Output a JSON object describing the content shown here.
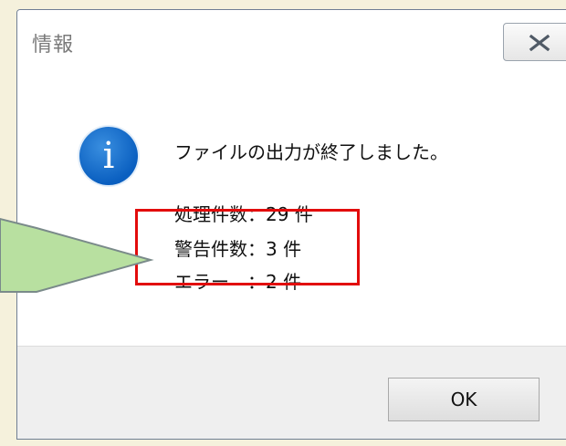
{
  "dialog": {
    "title": "情報",
    "message": "ファイルの出力が終了しました。",
    "lines": [
      "処理件数：29 件",
      "警告件数：3 件",
      "エラー　：2 件"
    ],
    "ok_label": "OK"
  },
  "colors": {
    "highlight_border": "#e20c0c",
    "callout_fill": "#b8e0a0",
    "info_icon": "#0a6fd1"
  },
  "icons": {
    "close": "close-icon",
    "info": "info-icon"
  }
}
